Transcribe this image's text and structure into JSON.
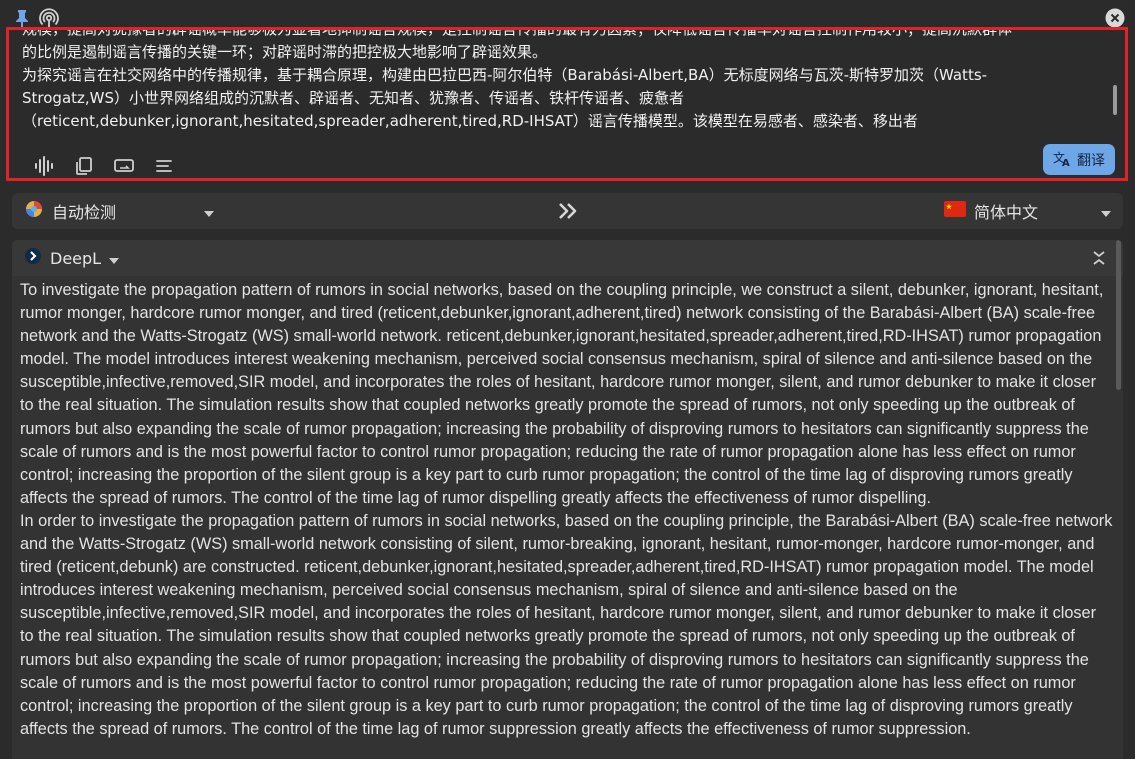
{
  "window": {
    "pin_icon": "pin-icon",
    "hotspot_icon": "broadcast-icon",
    "close_icon": "close-icon"
  },
  "source": {
    "lines": [
      "规模，提高对犹豫者的辟谣概率能够极为显著地抑制谣言规模，是控制谣言传播的最有力因素；仅降低谣言传播率对谣言控制作用较小；提高沉默群体",
      "的比例是遏制谣言传播的关键一环；对辟谣时滞的把控极大地影响了辟谣效果。",
      "为探究谣言在社交网络中的传播规律，基于耦合原理，构建由巴拉巴西-阿尔伯特（Barabási-Albert,BA）无标度网络与瓦茨-斯特罗加茨（Watts-",
      "Strogatz,WS）小世界网络组成的沉默者、辟谣者、无知者、犹豫者、传谣者、铁杆传谣者、疲惫者",
      "（reticent,debunker,ignorant,hesitated,spreader,adherent,tired,RD-IHSAT）谣言传播模型。该模型在易感者、感染者、移出者"
    ],
    "tools": [
      "speak-icon",
      "copy-icon",
      "swap-lines-icon",
      "format-text-icon"
    ],
    "translate_label": "翻译",
    "translate_icon": "translate-icon"
  },
  "lang_bar": {
    "source_lang": "自动检测",
    "source_icon": "auto-detect-icon",
    "swap_icon": "double-chevron-right-icon",
    "target_lang": "简体中文",
    "target_flag": "china-flag-icon"
  },
  "result": {
    "engine": "DeepL",
    "engine_icon": "deepl-logo-icon",
    "collapse_icon": "collapse-icon",
    "paragraphs": [
      "To investigate the propagation pattern of rumors in social networks, based on the coupling principle, we construct a silent, debunker, ignorant, hesitant, rumor monger, hardcore rumor monger, and tired (reticent,debunker,ignorant,adherent,tired) network consisting of the Barabási-Albert (BA) scale-free network and the Watts-Strogatz (WS) small-world network. reticent,debunker,ignorant,hesitated,spreader,adherent,tired,RD-IHSAT) rumor propagation model. The model introduces interest weakening mechanism, perceived social consensus mechanism, spiral of silence and anti-silence based on the susceptible,infective,removed,SIR model, and incorporates the roles of hesitant, hardcore rumor monger, silent, and rumor debunker to make it closer to the real situation. The simulation results show that coupled networks greatly promote the spread of rumors, not only speeding up the outbreak of rumors but also expanding the scale of rumor propagation; increasing the probability of disproving rumors to hesitators can significantly suppress the scale of rumors and is the most powerful factor to control rumor propagation; reducing the rate of rumor propagation alone has less effect on rumor control; increasing the proportion of the silent group is a key part to curb rumor propagation; the control of the time lag of disproving rumors greatly affects the spread of rumors. The control of the time lag of rumor dispelling greatly affects the effectiveness of rumor dispelling.",
      "In order to investigate the propagation pattern of rumors in social networks, based on the coupling principle, the Barabási-Albert (BA) scale-free network and the Watts-Strogatz (WS) small-world network consisting of silent, rumor-breaking, ignorant, hesitant, rumor-monger, hardcore rumor-monger, and tired (reticent,debunk) are constructed. reticent,debunker,ignorant,hesitated,spreader,adherent,tired,RD-IHSAT) rumor propagation model. The model introduces interest weakening mechanism, perceived social consensus mechanism, spiral of silence and anti-silence based on the susceptible,infective,removed,SIR model, and incorporates the roles of hesitant, hardcore rumor monger, silent, and rumor debunker to make it closer to the real situation. The simulation results show that coupled networks greatly promote the spread of rumors, not only speeding up the outbreak of rumors but also expanding the scale of rumor propagation; increasing the probability of disproving rumors to hesitators can significantly suppress the scale of rumors and is the most powerful factor to control rumor propagation; reducing the rate of rumor propagation alone has less effect on rumor control; increasing the proportion of the silent group is a key part to curb rumor propagation; the control of the time lag of disproving rumors greatly affects the spread of rumors. The control of the time lag of rumor suppression greatly affects the effectiveness of rumor suppression."
    ]
  },
  "colors": {
    "background": "#2b2b2b",
    "highlight_border": "#e0232b",
    "translate_button": "#6ea7e8",
    "panel": "#333333"
  }
}
